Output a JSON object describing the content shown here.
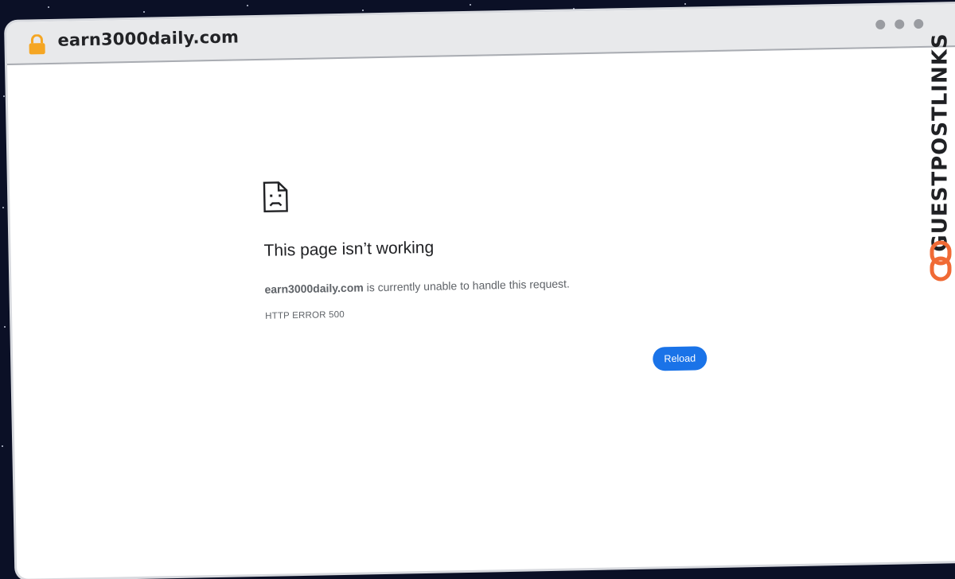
{
  "browser": {
    "url": "earn3000daily.com",
    "lock_icon": "lock-icon",
    "window_controls": [
      "dot",
      "dot",
      "dot"
    ]
  },
  "error_page": {
    "icon": "sad-page-icon",
    "title": "This page isn’t working",
    "domain": "earn3000daily.com",
    "message": " is currently unable to handle this request.",
    "code": "HTTP ERROR 500",
    "reload_label": "Reload"
  },
  "watermark": {
    "text": "GUESTPOSTLINKS",
    "logo_icon": "link-logo-icon"
  },
  "colors": {
    "accent": "#1a73e8",
    "lock": "#f5a623",
    "brand": "#f06a35",
    "background": "#0b1026"
  }
}
